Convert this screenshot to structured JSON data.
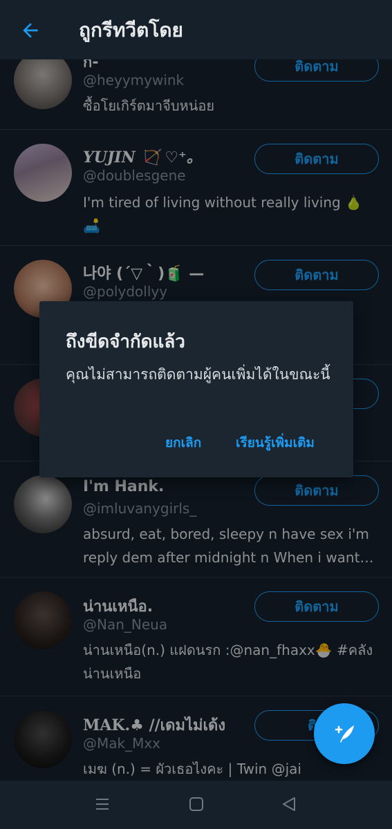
{
  "header": {
    "title": "ถูกรีทวีตโดย",
    "back_icon": "arrow-left-icon"
  },
  "colors": {
    "background": "#15202b",
    "accent": "#1d9bf0",
    "text_secondary": "#7d8b98"
  },
  "users": [
    {
      "name": "ก-",
      "handle": "@heyymywink",
      "bio": "ซื้อโยเกิร์ตมาจีบหน่อย",
      "follow_label": "ติดตาม"
    },
    {
      "name": "𝒀𝑼𝑱𝑰𝑵 🏹 ♡⁺。",
      "handle": "@doublesgene",
      "bio": "I'm tired of living without really living 🍐 🛋️",
      "follow_label": "ติดตาม"
    },
    {
      "name": "나야 (´▽｀)🧃 —",
      "handle": "@polydollyy",
      "bio": "",
      "follow_label": "ติดตาม"
    },
    {
      "name": "",
      "handle": "",
      "bio": "",
      "follow_label": ""
    },
    {
      "name": "I'm Hank.",
      "handle": "@imluvanygirls_",
      "bio": "absurd, eat, bored, sleepy n have sex i'm reply dem after midnight n When i want…",
      "follow_label": "ติดตาม"
    },
    {
      "name": "น่านเหนือ.",
      "handle": "@Nan_Neua",
      "bio": "น่านเหนือ(n.) แฝดนรก :@nan_fhaxx🐣 #คลังน่านเหนือ",
      "follow_label": "ติดตาม"
    },
    {
      "name": "𝐌𝐀𝐊.♣︎ //เดมไม่เด้ง",
      "handle": "@Mak_Mxx",
      "bio": "เมฆ (n.) =  ผัวเธอไงคะ   | Twin @jai",
      "follow_label": "ติด"
    }
  ],
  "dialog": {
    "title": "ถึงขีดจำกัดแล้ว",
    "message": "คุณไม่สามารถติดตามผู้คนเพิ่มได้ในขณะนี้",
    "cancel_label": "ยกเลิก",
    "learn_more_label": "เรียนรู้เพิ่มเติม"
  },
  "fab": {
    "icon": "compose-tweet-icon"
  },
  "navbar": {
    "icons": [
      "menu-icon",
      "home-square-icon",
      "back-triangle-icon"
    ]
  }
}
